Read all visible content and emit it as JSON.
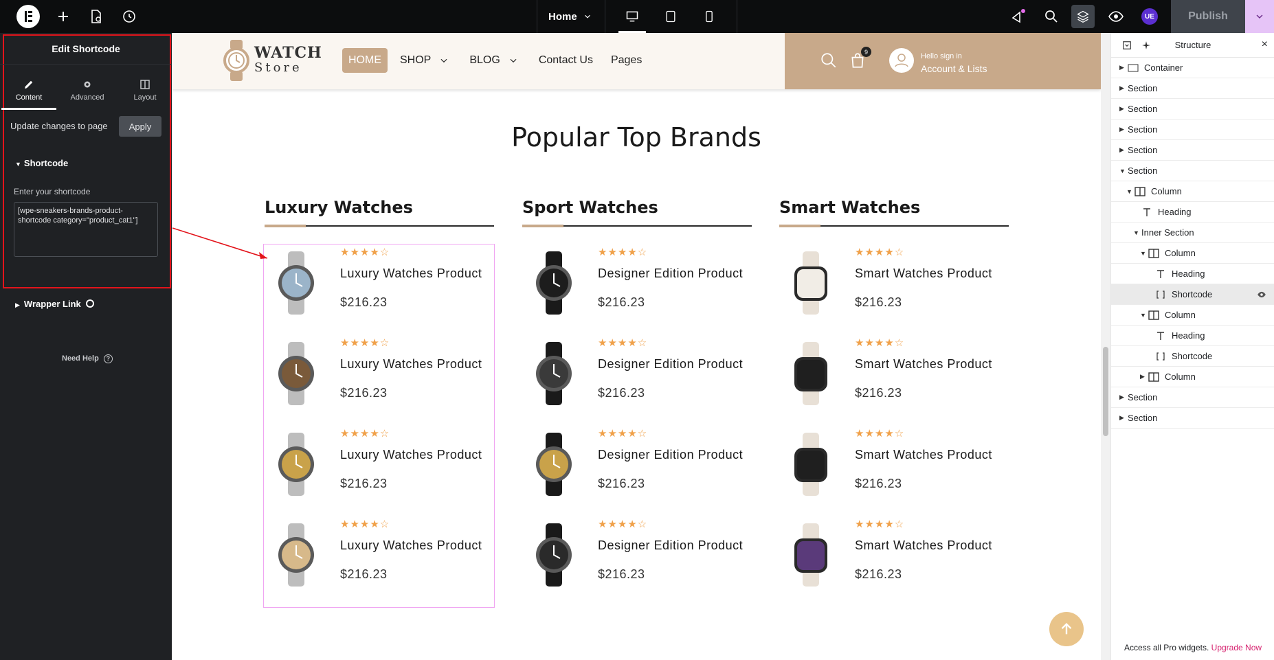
{
  "topbar": {
    "page_name": "Home",
    "publish_label": "Publish",
    "user_initials": "UE"
  },
  "left_panel": {
    "title": "Edit Shortcode",
    "tabs": [
      {
        "label": "Content",
        "icon": "pencil-icon"
      },
      {
        "label": "Advanced",
        "icon": "gear-icon"
      },
      {
        "label": "Layout",
        "icon": "layout-icon"
      }
    ],
    "update_text": "Update changes to page",
    "apply_label": "Apply",
    "section_title": "Shortcode",
    "field_label": "Enter your shortcode",
    "shortcode_value": "[wpe-sneakers-brands-product-shortcode category=\"product_cat1\"]",
    "wrapper_link": "Wrapper Link",
    "need_help": "Need Help"
  },
  "site": {
    "logo_top": "WATCH",
    "logo_bottom": "Store",
    "nav": [
      "HOME",
      "SHOP",
      "BLOG",
      "Contact Us",
      "Pages"
    ],
    "cart_count": "9",
    "account_hello": "Hello sign in",
    "account_main": "Account & Lists",
    "section_title": "Popular Top Brands"
  },
  "columns": [
    {
      "heading": "Luxury Watches",
      "products": [
        {
          "name": "Luxury Watches Product",
          "price": "$216.23"
        },
        {
          "name": "Luxury Watches Product",
          "price": "$216.23"
        },
        {
          "name": "Luxury Watches Product",
          "price": "$216.23"
        },
        {
          "name": "Luxury Watches Product",
          "price": "$216.23"
        }
      ]
    },
    {
      "heading": "Sport Watches",
      "products": [
        {
          "name": "Designer Edition Product",
          "price": "$216.23"
        },
        {
          "name": "Designer Edition Product",
          "price": "$216.23"
        },
        {
          "name": "Designer Edition Product",
          "price": "$216.23"
        },
        {
          "name": "Designer Edition Product",
          "price": "$216.23"
        }
      ]
    },
    {
      "heading": "Smart Watches",
      "products": [
        {
          "name": "Smart Watches Product",
          "price": "$216.23"
        },
        {
          "name": "Smart Watches Product",
          "price": "$216.23"
        },
        {
          "name": "Smart Watches Product",
          "price": "$216.23"
        },
        {
          "name": "Smart Watches Product",
          "price": "$216.23"
        }
      ]
    }
  ],
  "rating_stars": "★★★★☆",
  "structure": {
    "title": "Structure",
    "items": [
      {
        "label": "Container",
        "type": "container"
      },
      {
        "label": "Section",
        "type": "section"
      },
      {
        "label": "Section",
        "type": "section"
      },
      {
        "label": "Section",
        "type": "section"
      },
      {
        "label": "Section",
        "type": "section"
      },
      {
        "label": "Section",
        "type": "section"
      },
      {
        "label": "Column",
        "type": "column"
      },
      {
        "label": "Heading",
        "type": "heading"
      },
      {
        "label": "Inner Section",
        "type": "inner"
      },
      {
        "label": "Column",
        "type": "column"
      },
      {
        "label": "Heading",
        "type": "heading"
      },
      {
        "label": "Shortcode",
        "type": "shortcode"
      },
      {
        "label": "Column",
        "type": "column"
      },
      {
        "label": "Heading",
        "type": "heading"
      },
      {
        "label": "Shortcode",
        "type": "shortcode"
      },
      {
        "label": "Column",
        "type": "column"
      },
      {
        "label": "Section",
        "type": "section"
      },
      {
        "label": "Section",
        "type": "section"
      }
    ],
    "footer_text": "Access all Pro widgets.",
    "footer_link": "Upgrade Now"
  },
  "colors": {
    "accent": "#c8a98a",
    "star": "#f0a14a",
    "selection_red": "#e3141b",
    "upgrade_link": "#d6226f"
  }
}
